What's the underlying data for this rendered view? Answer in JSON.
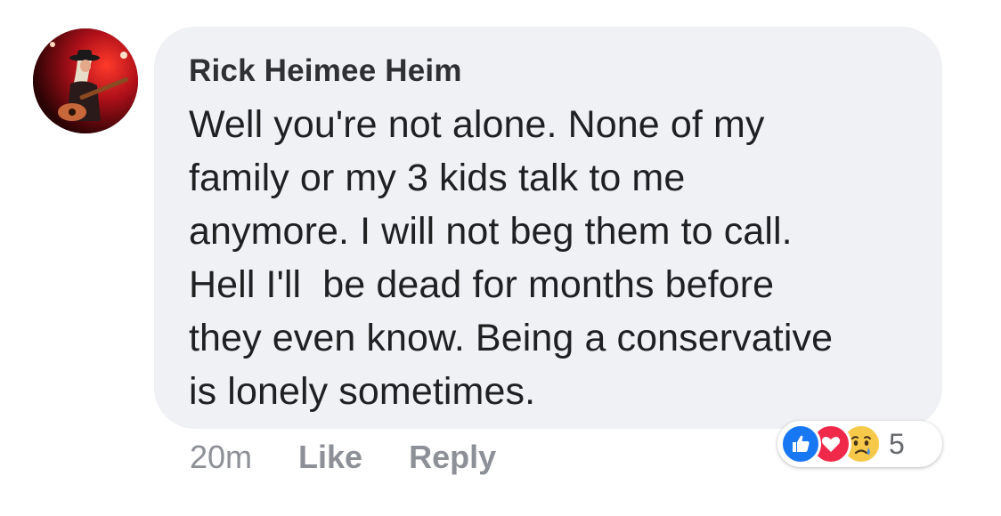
{
  "comment": {
    "author": "Rick Heimee Heim",
    "text": "Well you're not alone. None of my\nfamily or my 3 kids talk to me\nanymore. I will not beg them to call.\nHell I'll  be dead for months before\nthey even know. Being a conservative\nis lonely sometimes.",
    "avatar_icon": "profile-photo-guitarist"
  },
  "actions": {
    "timestamp": "20m",
    "like_label": "Like",
    "reply_label": "Reply"
  },
  "reactions": {
    "icons": [
      "like-icon",
      "love-icon",
      "sad-icon"
    ],
    "count": "5",
    "colors": {
      "like": "#1877f2",
      "love": "#f0284a",
      "sad": "#f7c94a"
    }
  }
}
